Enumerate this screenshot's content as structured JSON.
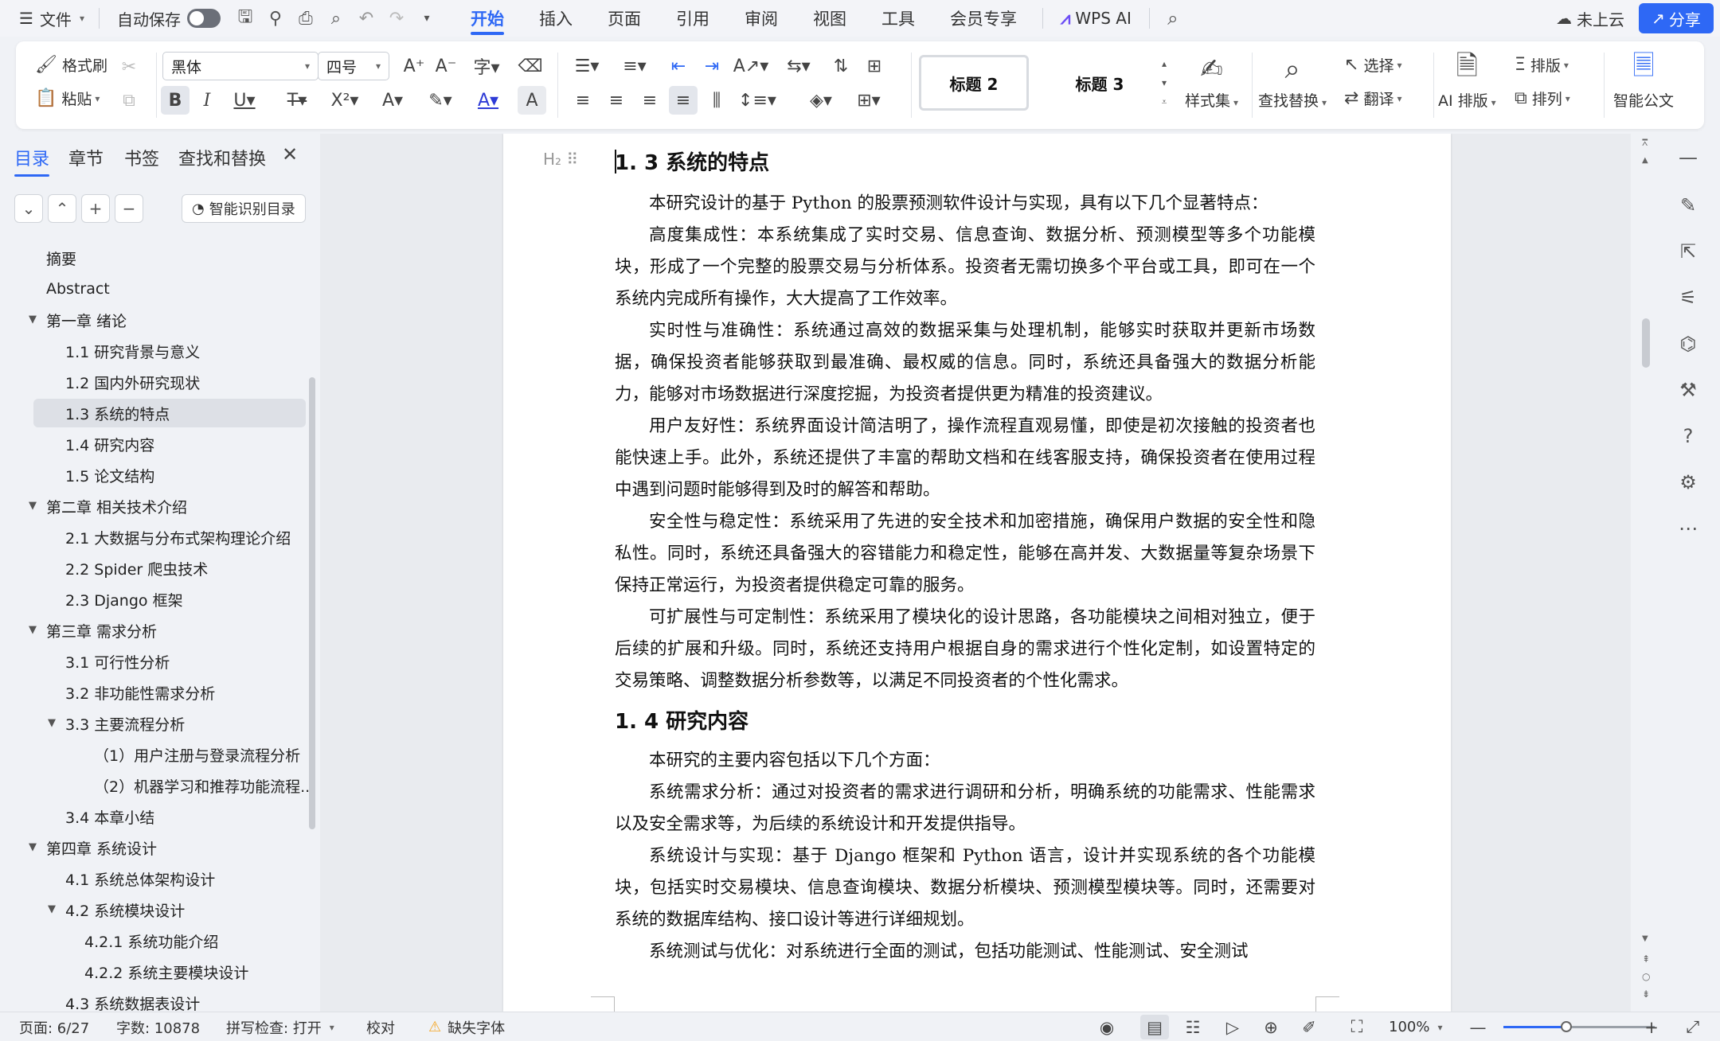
{
  "menubar": {
    "file": "文件",
    "autosave": "自动保存",
    "tabs": [
      "开始",
      "插入",
      "页面",
      "引用",
      "审阅",
      "视图",
      "工具",
      "会员专享"
    ],
    "ai": "WPS AI",
    "cloud": "未上云",
    "share": "分享"
  },
  "ribbon": {
    "format_painter": "格式刷",
    "paste": "粘贴",
    "font_name": "黑体",
    "font_size": "四号",
    "style_1": "标题 2",
    "style_2": "标题 3",
    "style_set": "样式集",
    "find_replace": "查找替换",
    "select": "选择",
    "translate": "翻译",
    "ai_layout": "AI 排版",
    "typeset": "排版",
    "arrange": "排列",
    "smart_doc": "智能公文"
  },
  "leftpanel": {
    "tabs": [
      "目录",
      "章节",
      "书签",
      "查找和替换"
    ],
    "smart_toc": "智能识别目录",
    "toc": [
      {
        "label": "摘要"
      },
      {
        "label": "Abstract"
      },
      {
        "label": "第一章  绪论"
      },
      {
        "label": "1.1 研究背景与意义"
      },
      {
        "label": "1.2 国内外研究现状"
      },
      {
        "label": "1.3 系统的特点"
      },
      {
        "label": "1.4 研究内容"
      },
      {
        "label": "1.5 论文结构"
      },
      {
        "label": "第二章  相关技术介绍"
      },
      {
        "label": "2.1  大数据与分布式架构理论介绍"
      },
      {
        "label": "2.2 Spider 爬虫技术"
      },
      {
        "label": "2.3 Django 框架"
      },
      {
        "label": "第三章  需求分析"
      },
      {
        "label": "3.1 可行性分析"
      },
      {
        "label": "3.2  非功能性需求分析"
      },
      {
        "label": "3.3 主要流程分析"
      },
      {
        "label": "（1）用户注册与登录流程分析"
      },
      {
        "label": "（2）机器学习和推荐功能流程..."
      },
      {
        "label": "3.4 本章小结"
      },
      {
        "label": "第四章  系统设计"
      },
      {
        "label": "4.1  系统总体架构设计"
      },
      {
        "label": "4.2  系统模块设计"
      },
      {
        "label": "4.2.1 系统功能介绍"
      },
      {
        "label": "4.2.2 系统主要模块设计"
      },
      {
        "label": "4.3  系统数据表设计"
      }
    ]
  },
  "document": {
    "heading_1": "1. 3 系统的特点",
    "paras_1": [
      "本研究设计的基于 Python 的股票预测软件设计与实现，具有以下几个显著特点：",
      "高度集成性：本系统集成了实时交易、信息查询、数据分析、预测模型等多个功能模块，形成了一个完整的股票交易与分析体系。投资者无需切换多个平台或工具，即可在一个系统内完成所有操作，大大提高了工作效率。",
      "实时性与准确性：系统通过高效的数据采集与处理机制，能够实时获取并更新市场数据，确保投资者能够获取到最准确、最权威的信息。同时，系统还具备强大的数据分析能力，能够对市场数据进行深度挖掘，为投资者提供更为精准的投资建议。",
      "用户友好性：系统界面设计简洁明了，操作流程直观易懂，即使是初次接触的投资者也能快速上手。此外，系统还提供了丰富的帮助文档和在线客服支持，确保投资者在使用过程中遇到问题时能够得到及时的解答和帮助。",
      "安全性与稳定性：系统采用了先进的安全技术和加密措施，确保用户数据的安全性和隐私性。同时，系统还具备强大的容错能力和稳定性，能够在高并发、大数据量等复杂场景下保持正常运行，为投资者提供稳定可靠的服务。",
      "可扩展性与可定制性：系统采用了模块化的设计思路，各功能模块之间相对独立，便于后续的扩展和升级。同时，系统还支持用户根据自身的需求进行个性化定制，如设置特定的交易策略、调整数据分析参数等，以满足不同投资者的个性化需求。"
    ],
    "heading_2": "1. 4 研究内容",
    "paras_2": [
      "本研究的主要内容包括以下几个方面：",
      "系统需求分析：通过对投资者的需求进行调研和分析，明确系统的功能需求、性能需求以及安全需求等，为后续的系统设计和开发提供指导。",
      "系统设计与实现：基于 Django 框架和 Python 语言，设计并实现系统的各个功能模块，包括实时交易模块、信息查询模块、数据分析模块、预测模型模块等。同时，还需要对系统的数据库结构、接口设计等进行详细规划。",
      "系统测试与优化：对系统进行全面的测试，包括功能测试、性能测试、安全测试"
    ]
  },
  "statusbar": {
    "page": "页面: 6/27",
    "words": "字数: 10878",
    "spell": "拼写检查: 打开",
    "proof": "校对",
    "missing_font": "缺失字体",
    "zoom": "100%"
  },
  "colors": {
    "accent": "#2e68f5",
    "warning": "#f5a623"
  }
}
